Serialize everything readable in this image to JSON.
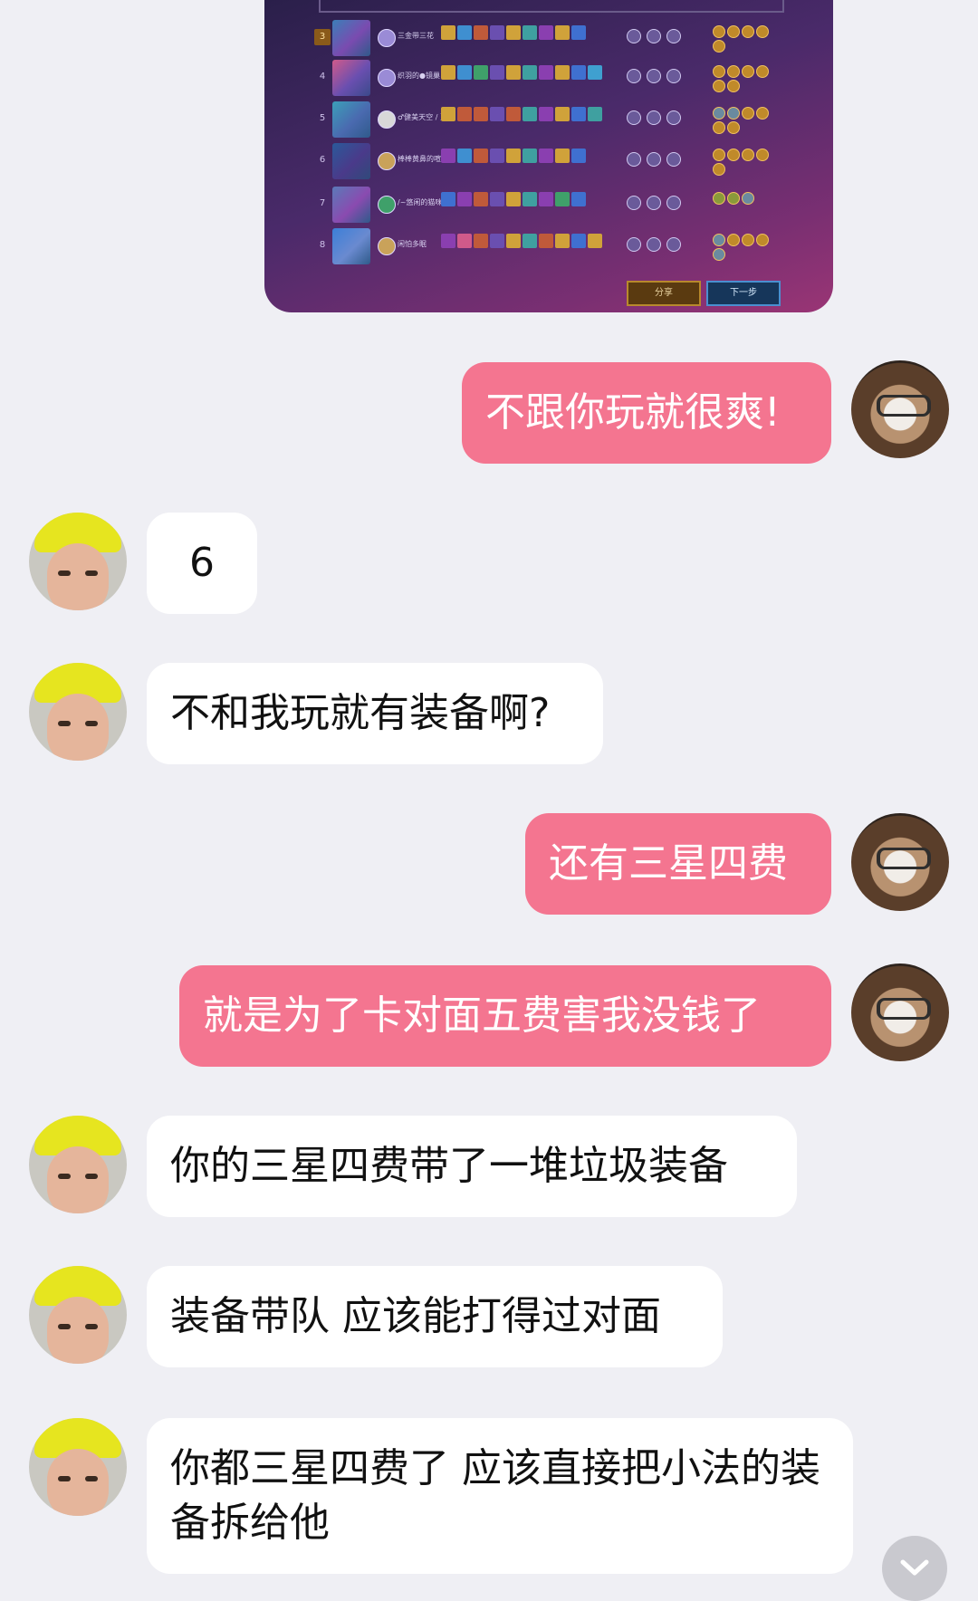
{
  "image_message": {
    "rows": [
      {
        "rank": "3",
        "name": "三金带三花",
        "highlight": true
      },
      {
        "rank": "4",
        "name": "织羽的●镜巢",
        "highlight": false
      },
      {
        "rank": "5",
        "name": "♂健美天空 / 豆浆",
        "highlight": false
      },
      {
        "rank": "6",
        "name": "棒棒黄鼻的喧嚣",
        "highlight": false
      },
      {
        "rank": "7",
        "name": "/~悠闲的猫咪",
        "highlight": false
      },
      {
        "rank": "8",
        "name": "闲怕多眠",
        "highlight": false
      }
    ],
    "share_label": "分享",
    "next_label": "下一步"
  },
  "messages": [
    {
      "side": "right",
      "text": "不跟你玩就很爽!"
    },
    {
      "side": "left",
      "text": "6"
    },
    {
      "side": "left",
      "text": "不和我玩就有装备啊?"
    },
    {
      "side": "right",
      "text": "还有三星四费"
    },
    {
      "side": "right",
      "text": "就是为了卡对面五费害我没钱了"
    },
    {
      "side": "left",
      "text": "你的三星四费带了一堆垃圾装备"
    },
    {
      "side": "left",
      "text": "装备带队 应该能打得过对面"
    },
    {
      "side": "left",
      "text": "你都三星四费了 应该直接把小法的装备拆给他"
    }
  ],
  "colors": {
    "background": "#efeff4",
    "self_bubble": "#f47590",
    "other_bubble": "#ffffff"
  },
  "icons": {
    "scroll_down": "chevron-down-icon"
  }
}
